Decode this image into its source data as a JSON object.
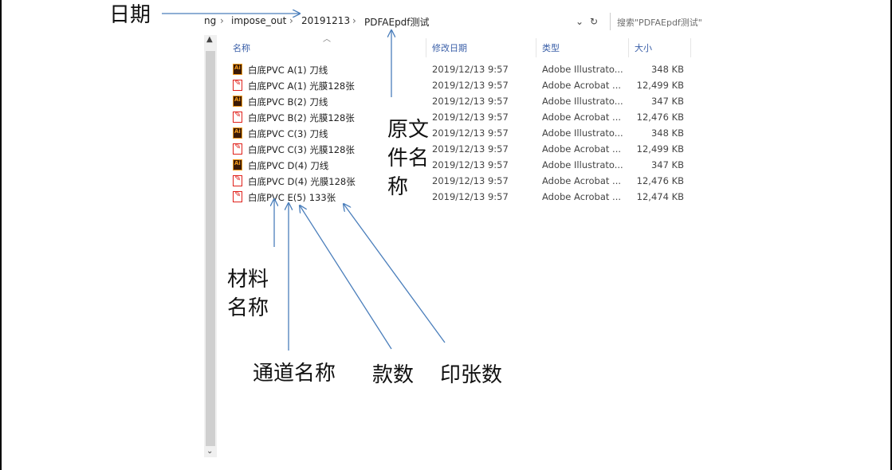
{
  "explorer": {
    "breadcrumb": [
      "ng",
      "impose_out",
      "20191213",
      "PDFAEpdf测试"
    ],
    "refresh_glyph": "↻",
    "dropdown_glyph": "⌄",
    "search_placeholder": "搜索\"PDFAEpdf测试\"",
    "columns": {
      "name": "名称",
      "date": "修改日期",
      "type": "类型",
      "size": "大小"
    },
    "files": [
      {
        "icon": "illustrator-file-icon",
        "name": "白底PVC  A(1)  刀线",
        "date": "2019/12/13 9:57",
        "type": "Adobe Illustrato...",
        "size": "348 KB"
      },
      {
        "icon": "pdf-file-icon",
        "name": "白底PVC  A(1)  光膜128张",
        "date": "2019/12/13 9:57",
        "type": "Adobe Acrobat ...",
        "size": "12,499 KB"
      },
      {
        "icon": "illustrator-file-icon",
        "name": "白底PVC  B(2)  刀线",
        "date": "2019/12/13 9:57",
        "type": "Adobe Illustrato...",
        "size": "347 KB"
      },
      {
        "icon": "pdf-file-icon",
        "name": "白底PVC  B(2)  光膜128张",
        "date": "2019/12/13 9:57",
        "type": "Adobe Acrobat ...",
        "size": "12,476 KB"
      },
      {
        "icon": "illustrator-file-icon",
        "name": "白底PVC  C(3)  刀线",
        "date": "2019/12/13 9:57",
        "type": "Adobe Illustrato...",
        "size": "348 KB"
      },
      {
        "icon": "pdf-file-icon",
        "name": "白底PVC  C(3)  光膜128张",
        "date": "2019/12/13 9:57",
        "type": "Adobe Acrobat ...",
        "size": "12,499 KB"
      },
      {
        "icon": "illustrator-file-icon",
        "name": "白底PVC  D(4)  刀线",
        "date": "2019/12/13 9:57",
        "type": "Adobe Illustrato...",
        "size": "347 KB"
      },
      {
        "icon": "pdf-file-icon",
        "name": "白底PVC  D(4)  光膜128张",
        "date": "2019/12/13 9:57",
        "type": "Adobe Acrobat ...",
        "size": "12,476 KB"
      },
      {
        "icon": "pdf-file-icon",
        "name": "白底PVC  E(5)  133张",
        "date": "2019/12/13 9:57",
        "type": "Adobe Acrobat ...",
        "size": "12,474 KB"
      }
    ]
  },
  "annotations": {
    "date": "日期",
    "original_name_1": "原文",
    "original_name_2": "件名",
    "original_name_3": "称",
    "material_1": "材料",
    "material_2": "名称",
    "channel": "通道名称",
    "style_count": "款数",
    "sheet_count": "印张数"
  },
  "colors": {
    "arrow": "#4a7ebb",
    "header_text": "#3a5fa8",
    "ai_icon": "#f19a1b",
    "pdf_icon": "#e0201a"
  }
}
